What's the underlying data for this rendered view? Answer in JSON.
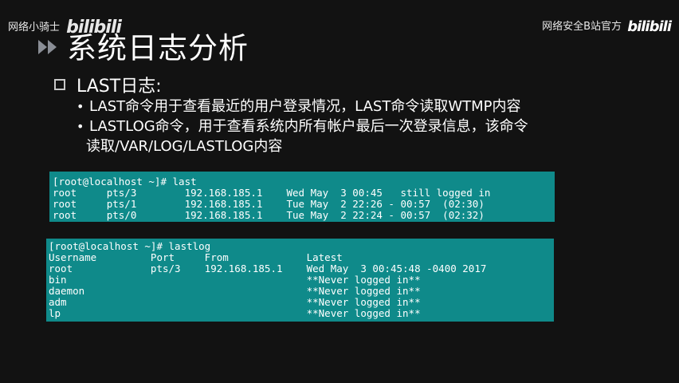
{
  "watermark": {
    "left_text": "网络小骑士",
    "left_logo": "bilibili",
    "right_text": "网络安全B站官方",
    "right_logo": "bilibili"
  },
  "slide": {
    "title": "系统日志分析",
    "main_bullet": "LAST日志:",
    "sub_bullets": [
      "LAST命令用于查看最近的用户登录情况，LAST命令读取WTMP内容",
      "LASTLOG命令，用于查看系统内所有帐户最后一次登录信息，该命令",
      "读取/VAR/LOG/LASTLOG内容"
    ]
  },
  "terminal_last": {
    "prompt": "[root@localhost ~]# last",
    "rows": [
      "root     pts/3        192.168.185.1    Wed May  3 00:45   still logged in",
      "root     pts/1        192.168.185.1    Tue May  2 22:26 - 00:57  (02:30)",
      "root     pts/0        192.168.185.1    Tue May  2 22:24 - 00:57  (02:32)"
    ]
  },
  "terminal_lastlog": {
    "prompt": "[root@localhost ~]# lastlog",
    "header": "Username         Port     From             Latest",
    "rows": [
      "root             pts/3    192.168.185.1    Wed May  3 00:45:48 -0400 2017",
      "bin                                        **Never logged in**",
      "daemon                                     **Never logged in**",
      "adm                                        **Never logged in**",
      "lp                                         **Never logged in**"
    ]
  },
  "colors": {
    "background": "#121212",
    "terminal_bg": "#0f8a8a",
    "text": "#ffffff",
    "arrow": "#8a8e96"
  },
  "icons": [
    "double-arrow-icon",
    "square-bullet-icon",
    "bilibili-logo"
  ]
}
